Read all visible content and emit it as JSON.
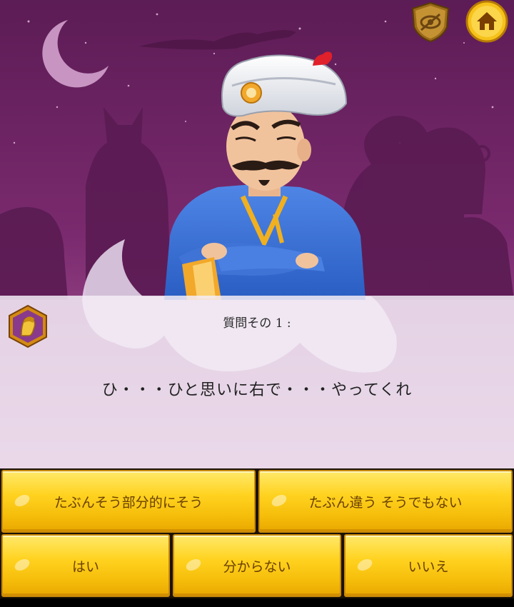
{
  "top_bar": {
    "hide_icon": "eye-slash-shield-icon",
    "home_icon": "home-icon"
  },
  "question": {
    "number": "質問その 1 :",
    "text": "ひ・・・ひと思いに右で・・・やってくれ",
    "badge_icon": "player-avatar-icon"
  },
  "answers": {
    "probably": "たぶんそう部分的にそう",
    "probably_not": "たぶん違う そうでもない",
    "yes": "はい",
    "dont_know": "分からない",
    "no": "いいえ"
  },
  "colors": {
    "sky": "#6b1f5c",
    "button": "#ffd21f",
    "button_text": "#6a4000"
  }
}
